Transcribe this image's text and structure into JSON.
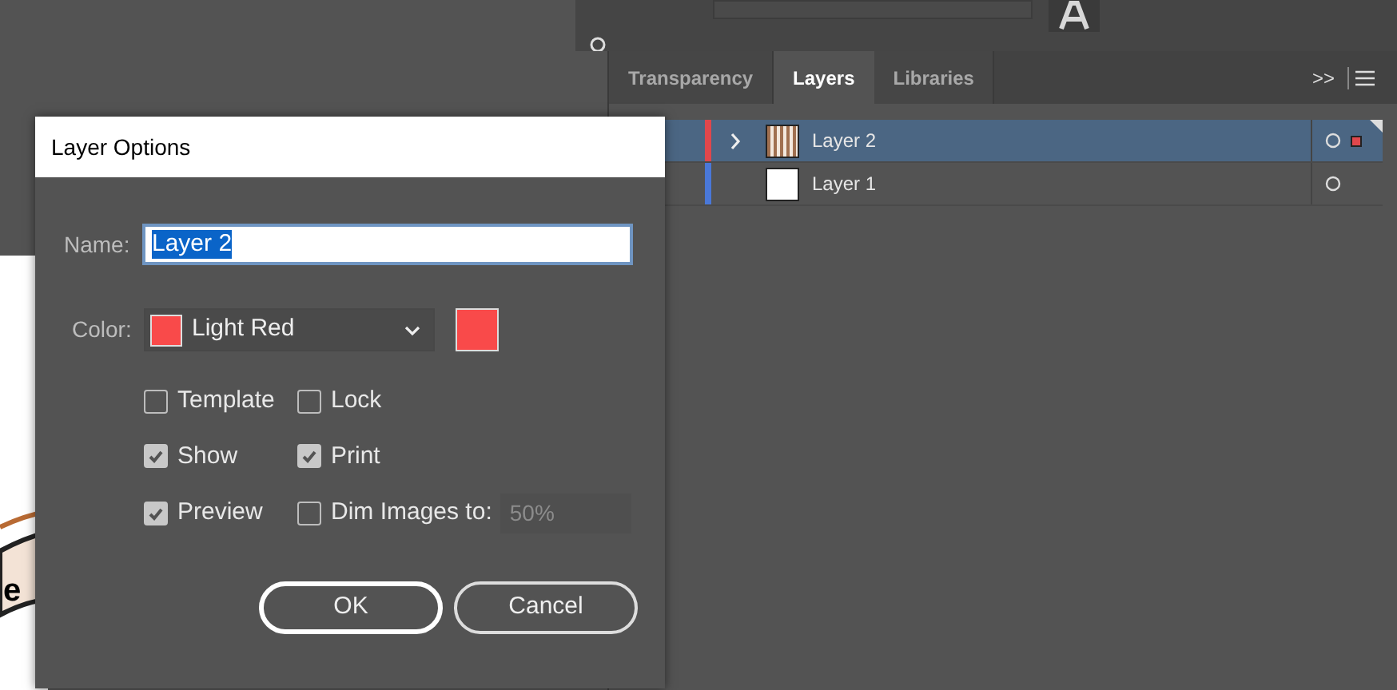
{
  "canvas": {
    "artwork_text": "e"
  },
  "layers_panel": {
    "tabs": [
      {
        "label": "Transparency",
        "selected": false
      },
      {
        "label": "Layers",
        "selected": true
      },
      {
        "label": "Libraries",
        "selected": false
      }
    ],
    "overflow": ">>",
    "layers": [
      {
        "name": "Layer 2",
        "color": "#e0474c",
        "selected": true,
        "has_children": true,
        "kind": "pattern"
      },
      {
        "name": "Layer 1",
        "color": "#4a78d8",
        "selected": false,
        "has_children": false,
        "kind": "blank"
      }
    ]
  },
  "dialog": {
    "title": "Layer Options",
    "name_label": "Name:",
    "name_value": "Layer 2",
    "color_label": "Color:",
    "color_value": "Light Red",
    "color": "#f94a4a",
    "options": [
      {
        "label": "Template",
        "checked": false
      },
      {
        "label": "Lock",
        "checked": false
      },
      {
        "label": "Show",
        "checked": true
      },
      {
        "label": "Print",
        "checked": true
      },
      {
        "label": "Preview",
        "checked": true
      },
      {
        "label": "Dim Images to:",
        "checked": false
      }
    ],
    "dim_value": "50%",
    "buttons": [
      "OK",
      "Cancel"
    ]
  }
}
